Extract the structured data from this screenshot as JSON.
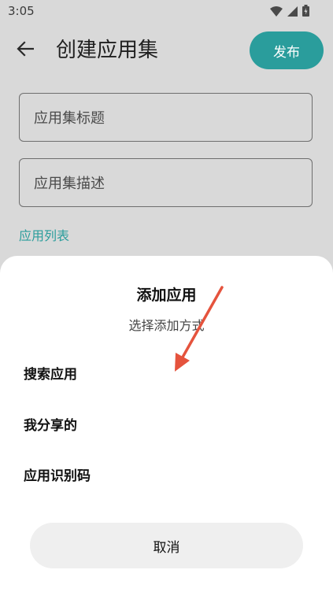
{
  "status_bar": {
    "time": "3:05",
    "icons": [
      "wifi-icon",
      "signal-icon",
      "battery-icon"
    ]
  },
  "app_bar": {
    "back_icon": "arrow-left-icon",
    "title": "创建应用集",
    "publish_label": "发布"
  },
  "form": {
    "title_placeholder": "应用集标题",
    "description_placeholder": "应用集描述",
    "app_list_label": "应用列表"
  },
  "sheet": {
    "title": "添加应用",
    "subtitle": "选择添加方式",
    "options": [
      {
        "label": "搜索应用"
      },
      {
        "label": "我分享的"
      },
      {
        "label": "应用识别码"
      }
    ],
    "cancel_label": "取消"
  },
  "colors": {
    "accent": "#2a9d9c",
    "scrim_background": "#d9d9d9",
    "sheet_background": "#ffffff",
    "cancel_background": "#efefef",
    "annotation_arrow": "#e5533d"
  }
}
